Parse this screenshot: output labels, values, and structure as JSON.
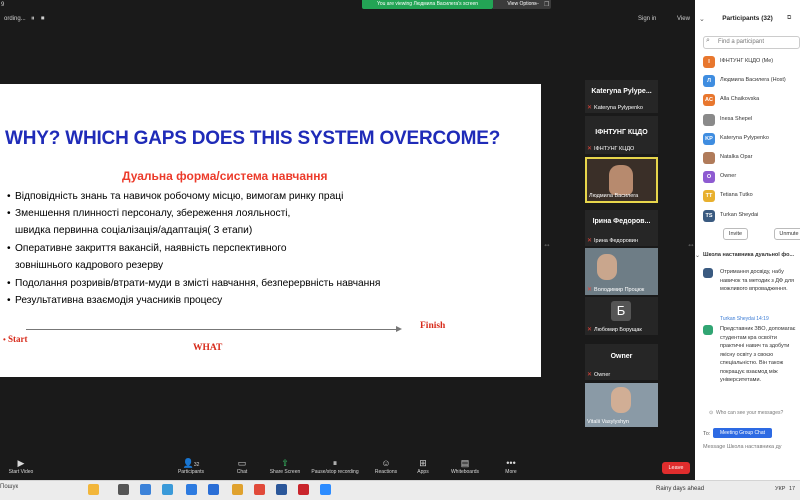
{
  "topbar": {
    "left_fragment": "9",
    "recording_label": "ording...",
    "viewing_banner": "You are viewing Людмила Василега's screen",
    "view_options": "View Options",
    "sign_in": "Sign in",
    "view": "View"
  },
  "slide": {
    "title": "WHY?  WHICH GAPS DOES THIS SYSTEM OVERCOME?",
    "subtitle": "Дуальна форма/система навчання",
    "bullets": [
      "Відповідність знань та навичок робочому місцю, вимогам ринку праці",
      "Зменшення плинності персоналу, збереження лояльності,",
      "Оперативне закриття вакансій, наявність перспективного",
      "Подолання розривів/втрати-муди  в змісті навчання, безперервність навчання",
      "Результативна взаємодія учасників процесу"
    ],
    "continuations": [
      "швидка первинна соціалізація/адаптація( 3 етапи)",
      "зовнішнього кадрового резерву"
    ],
    "start": "Start",
    "finish": "Finish",
    "what": "WHAT"
  },
  "thumbnails": [
    {
      "name": "Kateryna  Pylype...",
      "label": "Kateryna Pylypenko"
    },
    {
      "name": "ІФНТУНГ КЦДО",
      "label": "ІФНТУНГ КЦДО"
    },
    {
      "name": "",
      "label": "Людмила Василега"
    },
    {
      "name": "Ірина  Федоров...",
      "label": "Ірина Федоровин"
    },
    {
      "name": "",
      "label": "Володимир Процюк"
    },
    {
      "name": "Б",
      "label": "Любомир Борущак"
    },
    {
      "name": "Owner",
      "label": "Owner"
    },
    {
      "name": "",
      "label": "Vitalii Vasylyshyn"
    }
  ],
  "participants_panel": {
    "title": "Participants (32)",
    "search_placeholder": "Find a participant",
    "participants": [
      {
        "initial": "І",
        "name": "ІФНТУНГ КЦДО (Me)",
        "color": "#e8772e"
      },
      {
        "initial": "Л",
        "name": "Людмила Василега (Host)",
        "color": "#3f8de0"
      },
      {
        "initial": "AC",
        "name": "Alla Chaikovska",
        "color": "#e8772e"
      },
      {
        "initial": "",
        "name": "Inesa Shepel",
        "color": "#8a8a8a"
      },
      {
        "initial": "KP",
        "name": "Kateryna Pylypenko",
        "color": "#3f8de0"
      },
      {
        "initial": "",
        "name": "Natalka Opar",
        "color": "#b07b5a"
      },
      {
        "initial": "O",
        "name": "Owner",
        "color": "#8e5bd1"
      },
      {
        "initial": "TT",
        "name": "Tetiana Tutko",
        "color": "#e8b02e"
      },
      {
        "initial": "TS",
        "name": "Turkan Sheydai",
        "color": "#3a5a80"
      }
    ],
    "invite": "Invite",
    "unmute": "Unmute"
  },
  "chat": {
    "title": "Школа наставника дуальної фо...",
    "msg1": "Отримання досвіду, набу навичок та методик з ДФ для можливого впровадження.",
    "sender2": "Turkan Sheydai  14:19",
    "msg2": "Представник ЗВО, допомагає студентам кра освоїти практичні навич та здобути якісну освіту з своєю спеціальністю. Він також покращує взаємод між університетами.",
    "who_can_see": "Who can see your messages?",
    "to_label": "To:",
    "recipient": "Meeting Group Chat",
    "input_placeholder": "Message Школа наставника ду"
  },
  "toolbar": {
    "start_video": "Start Video",
    "participants": "Participants",
    "participants_count": "32",
    "chat": "Chat",
    "share_screen": "Share Screen",
    "pause_recording": "Pause/stop recording",
    "reactions": "Reactions",
    "apps": "Apps",
    "whiteboards": "Whiteboards",
    "more": "More",
    "leave": "Leave"
  },
  "taskbar": {
    "search": "Пошук",
    "weather": "Rainy days ahead",
    "lang": "УКР",
    "time": "17"
  }
}
